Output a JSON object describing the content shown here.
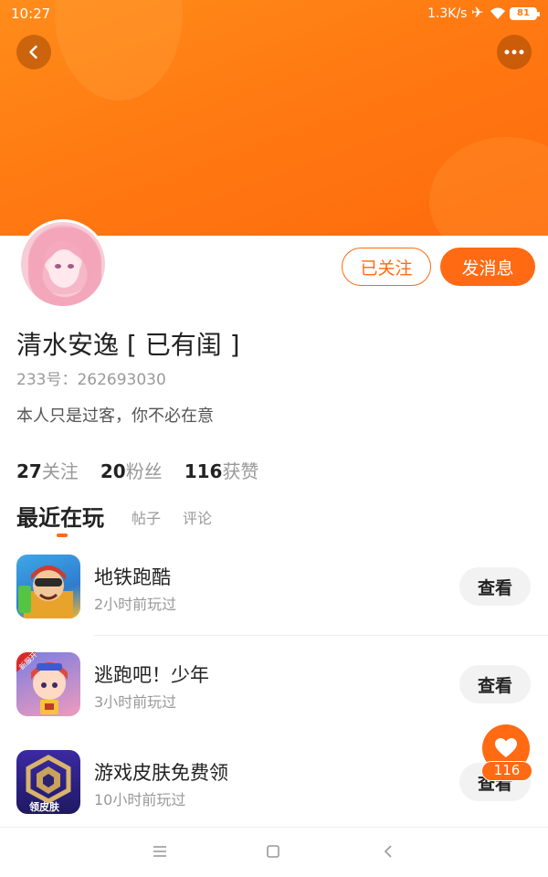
{
  "status_bar": {
    "time": "10:27",
    "network_speed": "1.3K/s",
    "battery": "81"
  },
  "header": {
    "back_icon": "chevron-left-icon",
    "more_icon": "more-dots-icon"
  },
  "profile": {
    "follow_button": "已关注",
    "message_button": "发消息",
    "nickname": "清水安逸 [ 已有闺 ]",
    "uid": "233号：262693030",
    "bio": "本人只是过客，你不必在意",
    "stats": [
      {
        "value": "27",
        "label": "关注"
      },
      {
        "value": "20",
        "label": "粉丝"
      },
      {
        "value": "116",
        "label": "获赞"
      }
    ]
  },
  "tabs": [
    {
      "label": "最近在玩",
      "active": true
    },
    {
      "label": "帖子",
      "active": false
    },
    {
      "label": "评论",
      "active": false
    }
  ],
  "games": [
    {
      "name": "地铁跑酷",
      "played": "2小时前玩过",
      "action": "查看"
    },
    {
      "name": "逃跑吧！少年",
      "played": "3小时前玩过",
      "action": "查看"
    },
    {
      "name": "游戏皮肤免费领",
      "played": "10小时前玩过",
      "action": "查看"
    }
  ],
  "game_icon_badges": {
    "run_badge": "新服开",
    "skin_label": "领皮肤"
  },
  "like_float": {
    "count": "116"
  },
  "colors": {
    "accent": "#ff6a13",
    "banner": "#ff7a12"
  }
}
